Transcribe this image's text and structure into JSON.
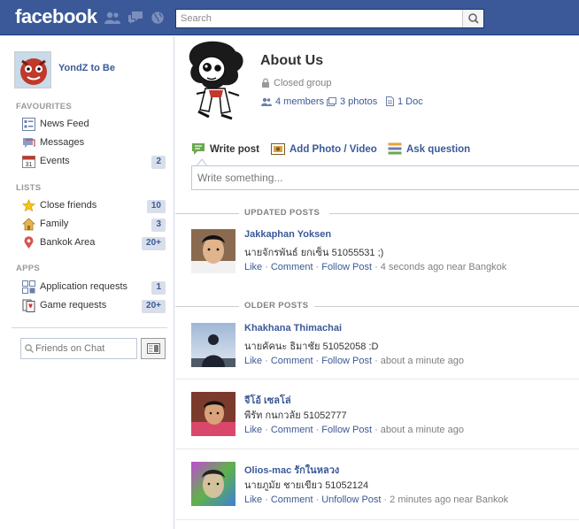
{
  "header": {
    "logo": "facebook",
    "search": {
      "placeholder": "Search",
      "value": ""
    }
  },
  "sidebar": {
    "profile_name": "YondZ to Be",
    "favourites_title": "FAVOURITES",
    "favourites": [
      {
        "label": "News Feed",
        "count": "",
        "icon": "news-feed-icon"
      },
      {
        "label": "Messages",
        "count": "",
        "icon": "messages-icon"
      },
      {
        "label": "Events",
        "count": "2",
        "icon": "calendar-icon"
      }
    ],
    "lists_title": "LISTS",
    "lists": [
      {
        "label": "Close friends",
        "count": "10",
        "icon": "star-icon"
      },
      {
        "label": "Family",
        "count": "3",
        "icon": "house-icon"
      },
      {
        "label": "Bankok Area",
        "count": "20+",
        "icon": "location-pin-icon"
      }
    ],
    "apps_title": "APPS",
    "apps": [
      {
        "label": "Application requests",
        "count": "1",
        "icon": "app-requests-icon"
      },
      {
        "label": "Game requests",
        "count": "20+",
        "icon": "game-requests-icon"
      }
    ],
    "chat_placeholder": "Friends on Chat"
  },
  "group": {
    "title": "About Us",
    "privacy": "Closed group",
    "members": "4 members",
    "photos": "3 photos",
    "docs": "1 Doc"
  },
  "composer": {
    "tabs": [
      "Write post",
      "Add Photo / Video",
      "Ask question"
    ],
    "placeholder": "Write something..."
  },
  "sections": {
    "updated": "UPDATED POSTS",
    "older": "OLDER POSTS"
  },
  "posts": [
    {
      "author": "Jakkaphan Yoksen",
      "text": "นายจักรพันธ์ ยกเซ็น 51055531 ;)",
      "actions": [
        "Like",
        "Comment",
        "Follow Post"
      ],
      "time": "4 seconds ago near Bangkok"
    },
    {
      "author": "Khakhana Thimachai",
      "text": "นายคัคนะ ธิมาชัย 51052058 :D",
      "actions": [
        "Like",
        "Comment",
        "Follow Post"
      ],
      "time": "about a minute ago"
    },
    {
      "author": "จีโอ้ เซลโล่",
      "text": "พีรัท กนกวลัย 51052777",
      "actions": [
        "Like",
        "Comment",
        "Follow Post"
      ],
      "time": "about a minute ago"
    },
    {
      "author": "Olios-mac รักในหลวง",
      "text": "นายภูมัย ชายเขียว 51052124",
      "actions": [
        "Like",
        "Comment",
        "Unfollow Post"
      ],
      "time": "2 minutes ago near Bankok"
    }
  ],
  "colors": {
    "brand": "#3b5998",
    "count_badge_bg": "#d8dfea",
    "text": "#333333",
    "muted": "#808080"
  }
}
